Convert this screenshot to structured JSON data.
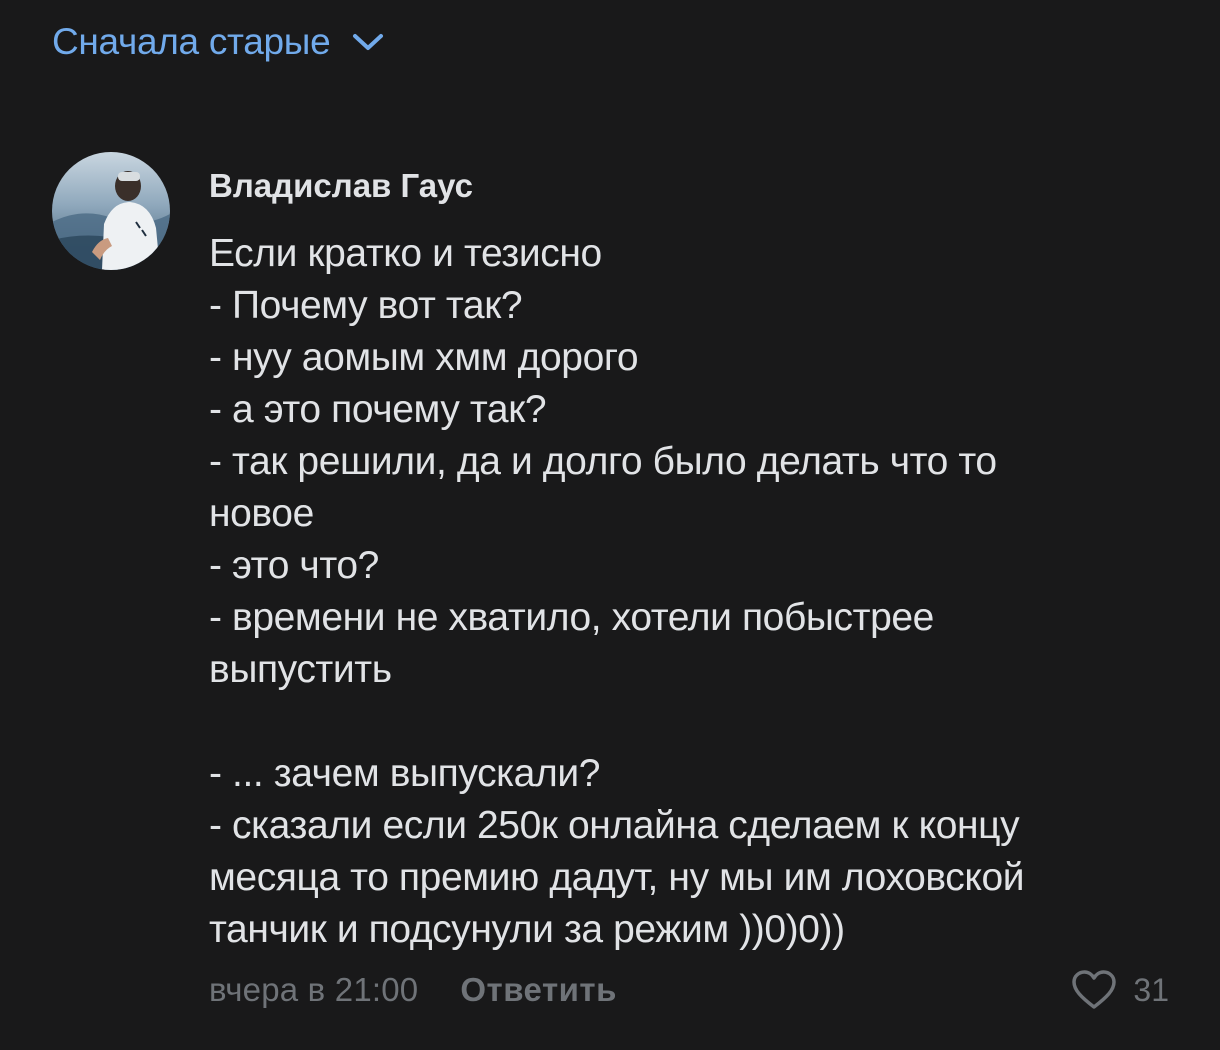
{
  "sort": {
    "label": "Сначала старые",
    "icon": "chevron-down-icon"
  },
  "comment": {
    "author": "Владислав Гаус",
    "text_lines": [
      "Если кратко и тезисно",
      "- Почему вот так?",
      "- нуу аомым хмм дорого",
      "- а это почему так?",
      "- так решили, да и долго было делать что то",
      "новое",
      "- это что?",
      "- времени не хватило, хотели побыстрее",
      "выпустить",
      "",
      "- ... зачем выпускали?",
      "- сказали если 250к онлайна сделаем к концу",
      "месяца то премию дадут, ну мы им лоховской",
      "танчик и подсунули за режим ))0)0))"
    ],
    "date": "вчера в 21:00",
    "reply_label": "Ответить",
    "likes": "31",
    "like_icon": "heart-icon"
  },
  "colors": {
    "background": "#19191a",
    "accent": "#71aaeb",
    "text": "#e1e3e6",
    "secondary": "#6f7378"
  }
}
